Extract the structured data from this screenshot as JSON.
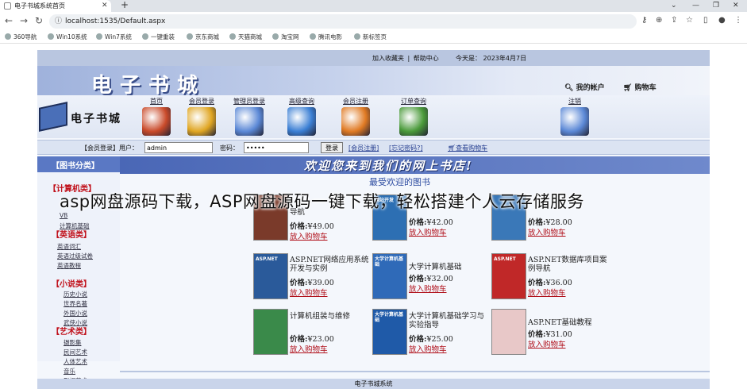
{
  "browser": {
    "tab_title": "电子书城系统首页",
    "url": "localhost:1535/Default.aspx",
    "bookmarks": [
      "360导航",
      "Win10系统",
      "Win7系统",
      "一键重装",
      "京东商城",
      "天猫商城",
      "淘宝网",
      "腾讯电影",
      "新标签页"
    ]
  },
  "top": {
    "links": [
      "加入收藏夹",
      "|",
      "帮助中心"
    ],
    "date": "今天是： 2023年4月7日"
  },
  "banner": {
    "title": "电子书城",
    "my_account": "我的帐户",
    "cart": "购物车"
  },
  "logo_text": "电子书城",
  "nav": [
    {
      "label": "首页",
      "color": "#c94a2a"
    },
    {
      "label": "会员登录",
      "color": "#e0a623"
    },
    {
      "label": "管理员登录",
      "color": "#5b88d6"
    },
    {
      "label": "高级查询",
      "color": "#3b7fd4"
    },
    {
      "label": "会员注册",
      "color": "#e07a23"
    },
    {
      "label": "订单查询",
      "color": "#4a9a3a"
    },
    {
      "label": "注销",
      "color": "#5b88d6"
    }
  ],
  "login": {
    "label_member": "【会员登录】用户：",
    "username": "admin",
    "label_password": "密码：",
    "password": "•••••",
    "login_button": "登录",
    "register_link": "会员注册",
    "forgot_link": "忘记密码?",
    "cart_link": "查看购物车"
  },
  "sidebar": {
    "head": "【图书分类】",
    "categories": [
      {
        "title": "【计算机类】",
        "items": [
          "VB",
          "计算机基础"
        ]
      },
      {
        "title": "【英语类】",
        "items": [
          "英语词汇",
          "英语过级试卷",
          "英语教程"
        ]
      },
      {
        "title": "【小说类】",
        "items": [
          "历史小说",
          "世界名著",
          "外国小说",
          "武侠小说"
        ]
      },
      {
        "title": "【艺术类】",
        "items": [
          "摄影集",
          "民间艺术",
          "人体艺术",
          "音乐",
          "影视艺术"
        ]
      }
    ]
  },
  "welcome": "欢迎您来到我们的网上书店!",
  "section_title": "最受欢迎的图书",
  "books": [
    {
      "name": "导航",
      "price_label": "价格:",
      "price": "¥49.00",
      "cart": "放入购物车",
      "cover_color": "#7a3a2a",
      "cover_text": ""
    },
    {
      "name": "",
      "price_label": "价格:",
      "price": "¥42.00",
      "cart": "放入购物车",
      "cover_color": "#2d6fb3",
      "cover_text": "网站开发"
    },
    {
      "name": "",
      "price_label": "价格:",
      "price": "¥28.00",
      "cart": "放入购物车",
      "cover_color": "#3a78b8",
      "cover_text": ""
    },
    {
      "name": "ASP.NET网络应用系统开发与实例",
      "price_label": "价格:",
      "price": "¥39.00",
      "cart": "放入购物车",
      "cover_color": "#2a5a9a",
      "cover_text": "ASP.NET"
    },
    {
      "name": "大学计算机基础",
      "price_label": "价格:",
      "price": "¥32.00",
      "cart": "放入购物车",
      "cover_color": "#2f6ab8",
      "cover_text": "大学计算机基础"
    },
    {
      "name": "ASP.NET数据库项目案例导航",
      "price_label": "价格:",
      "price": "¥36.00",
      "cart": "放入购物车",
      "cover_color": "#c02828",
      "cover_text": "ASP.NET"
    },
    {
      "name": "计算机组装与维修",
      "price_label": "价格:",
      "price": "¥23.00",
      "cart": "放入购物车",
      "cover_color": "#3a8a4a",
      "cover_text": ""
    },
    {
      "name": "大学计算机基础学习与实验指导",
      "price_label": "价格:",
      "price": "¥25.00",
      "cart": "放入购物车",
      "cover_color": "#1f5aa8",
      "cover_text": "大学计算机基础"
    },
    {
      "name": "ASP.NET基础教程",
      "price_label": "价格:",
      "price": "¥31.00",
      "cart": "放入购物车",
      "cover_color": "#e8c8c8",
      "cover_text": ""
    }
  ],
  "footer": "电子书城系统",
  "watermark": "asp网盘源码下载，ASP网盘源码一键下载，轻松搭建个人云存储服务"
}
